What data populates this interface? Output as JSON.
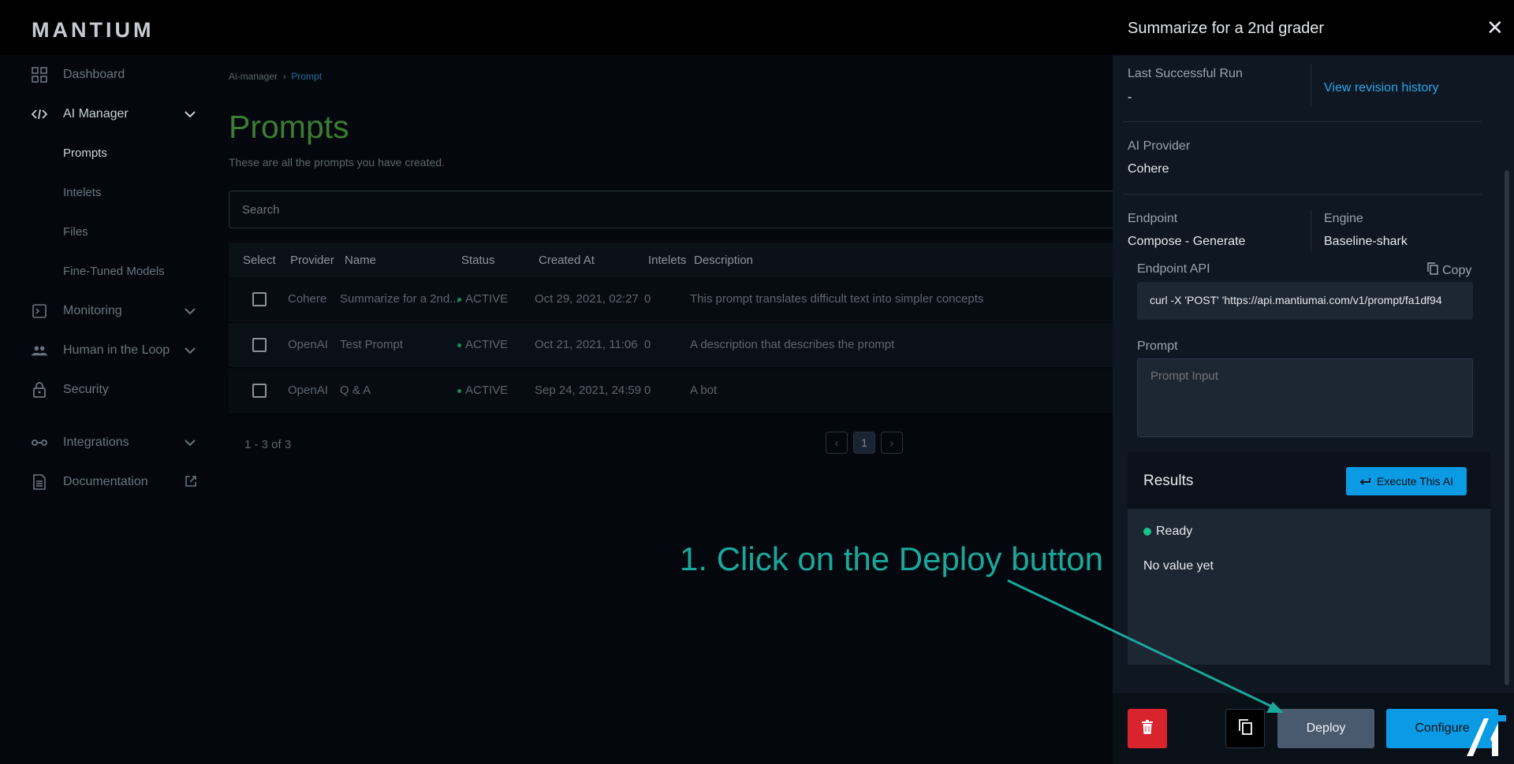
{
  "brand": {
    "logo_text": "MANTIUM"
  },
  "sidebar": {
    "items": [
      {
        "label": "Dashboard",
        "icon": "grid-icon"
      },
      {
        "label": "AI Manager",
        "icon": "code-icon"
      },
      {
        "label": "Monitoring",
        "icon": "terminal-icon"
      },
      {
        "label": "Human in the Loop",
        "icon": "people-icon"
      },
      {
        "label": "Security",
        "icon": "lock-icon"
      },
      {
        "label": "Integrations",
        "icon": "link-icon"
      },
      {
        "label": "Documentation",
        "icon": "document-icon"
      }
    ],
    "sub_items": [
      "Prompts",
      "Intelets",
      "Files",
      "Fine-Tuned Models"
    ]
  },
  "main": {
    "breadcrumb": {
      "parent": "Ai-manager",
      "separator": "›",
      "current": "Prompt"
    },
    "title": "Prompts",
    "subtitle": "These are all the prompts you have created.",
    "search_placeholder": "Search",
    "columns": [
      "Select",
      "Provider",
      "Name",
      "Status",
      "Created At",
      "Intelets",
      "Description"
    ],
    "rows": [
      {
        "provider": "Cohere",
        "name": "Summarize for a 2nd...",
        "status": "ACTIVE",
        "created_at": "Oct 29, 2021, 02:27",
        "intelets": "0",
        "description": "This prompt translates difficult text into simpler concepts"
      },
      {
        "provider": "OpenAI",
        "name": "Test Prompt",
        "status": "ACTIVE",
        "created_at": "Oct 21, 2021, 11:06",
        "intelets": "0",
        "description": "A description that describes the prompt"
      },
      {
        "provider": "OpenAI",
        "name": "Q & A",
        "status": "ACTIVE",
        "created_at": "Sep 24, 2021, 24:59",
        "intelets": "0",
        "description": "A bot"
      }
    ],
    "pagination": {
      "info": "1 - 3 of 3",
      "current_page": "1",
      "prev": "‹",
      "next": "›"
    }
  },
  "annotation": {
    "text": "1. Click on the Deploy button",
    "color": "#1aa89a"
  },
  "panel": {
    "title": "Summarize for a 2nd grader",
    "close": "✕",
    "last_run_label": "Last Successful Run",
    "last_run_value": "-",
    "revision_link": "View revision history",
    "provider_label": "AI Provider",
    "provider_value": "Cohere",
    "endpoint_label": "Endpoint",
    "endpoint_value": "Compose - Generate",
    "engine_label": "Engine",
    "engine_value": "Baseline-shark",
    "endpoint_api_label": "Endpoint API",
    "copy_label": "Copy",
    "api_value": "curl -X 'POST' 'https://api.mantiumai.com/v1/prompt/fa1df94",
    "prompt_label": "Prompt",
    "prompt_placeholder": "Prompt Input",
    "results_title": "Results",
    "execute_label": "Execute This AI",
    "status_text": "Ready",
    "no_value_text": "No value yet",
    "deploy_label": "Deploy",
    "configure_label": "Configure"
  },
  "colors": {
    "accent": "#0a9be4",
    "danger": "#d9232d",
    "success": "#19c48a",
    "link": "#2aa7e8"
  }
}
